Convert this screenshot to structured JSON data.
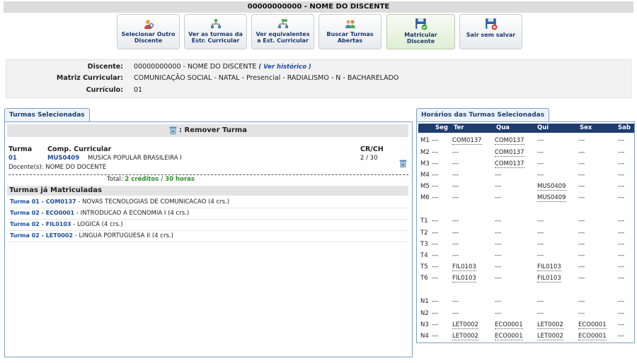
{
  "page_title": "00000000000 - NOME DO DISCENTE",
  "toolbar": [
    {
      "line1": "Selecionar Outro",
      "line2": "Discente",
      "icon": "user-search-icon"
    },
    {
      "line1": "Ver as turmas da",
      "line2": "Estr. Curricular",
      "icon": "hierarchy-icon"
    },
    {
      "line1": "Ver equivalentes",
      "line2": "a Est. Curricular",
      "icon": "hierarchy-plus-icon"
    },
    {
      "line1": "Buscar Turmas",
      "line2": "Abertas",
      "icon": "search-people-icon"
    },
    {
      "line1": "Matricular",
      "line2": "Discente",
      "icon": "save-check-icon"
    },
    {
      "line1": "Sair sem salvar",
      "line2": "",
      "icon": "save-cancel-icon"
    }
  ],
  "info": {
    "discente_label": "Discente:",
    "discente_value": "00000000000 - NOME DO DISCENTE",
    "historico_link": "( Ver histórico )",
    "matriz_label": "Matriz Curricular:",
    "matriz_value": "COMUNICAÇÃO SOCIAL - NATAL - Presencial - RADIALISMO - N - BACHARELADO",
    "curriculo_label": "Currículo:",
    "curriculo_value": "01"
  },
  "selected_tab": "Turmas Selecionadas",
  "remove_label": ": Remover Turma",
  "selected_headers": {
    "turma": "Turma",
    "comp": "Comp. Curricular",
    "crch": "CR/CH"
  },
  "selected_rows": [
    {
      "turma": "01",
      "code": "MUS0409",
      "name": "MUSICA POPULAR BRASILEIRA I",
      "crch": "2 / 30",
      "docente": "Docente(s): NOME DO DOCENTE"
    }
  ],
  "total_prefix": "Total:",
  "total_value": "2 créditos / 30 horas",
  "matriculadas_title": "Turmas já Matriculadas",
  "matriculadas": [
    {
      "turma": "Turma 01 -",
      "code": "COM0137",
      "desc": "- NOVAS TECNOLOGIAS DE COMUNICACAO (4 crs.)"
    },
    {
      "turma": "Turma 02 -",
      "code": "ECO0001",
      "desc": "- INTRODUCAO A ECONOMIA I (4 crs.)"
    },
    {
      "turma": "Turma 02 -",
      "code": "FIL0103",
      "desc": "- LOGICA (4 crs.)"
    },
    {
      "turma": "Turma 02 -",
      "code": "LET0002",
      "desc": "- LINGUA PORTUGUESA II (4 crs.)"
    }
  ],
  "schedule_tab": "Horários das Turmas Selecionadas",
  "schedule_days": [
    "Seg",
    "Ter",
    "Qua",
    "Qui",
    "Sex",
    "Sab"
  ],
  "schedule_rows": [
    {
      "slot": "M1",
      "cells": [
        "---",
        "COM0137",
        "COM0137",
        "---",
        "---",
        "---"
      ]
    },
    {
      "slot": "M2",
      "cells": [
        "---",
        "---",
        "COM0137",
        "---",
        "---",
        "---"
      ]
    },
    {
      "slot": "M3",
      "cells": [
        "---",
        "---",
        "COM0137",
        "---",
        "---",
        "---"
      ]
    },
    {
      "slot": "M4",
      "cells": [
        "---",
        "---",
        "---",
        "---",
        "---",
        "---"
      ]
    },
    {
      "slot": "M5",
      "cells": [
        "---",
        "---",
        "---",
        "MUS0409",
        "---",
        "---"
      ]
    },
    {
      "slot": "M6",
      "cells": [
        "---",
        "---",
        "---",
        "MUS0409",
        "---",
        "---"
      ]
    },
    {
      "slot": "T1",
      "cells": [
        "---",
        "---",
        "---",
        "---",
        "---",
        "---"
      ]
    },
    {
      "slot": "T2",
      "cells": [
        "---",
        "---",
        "---",
        "---",
        "---",
        "---"
      ]
    },
    {
      "slot": "T3",
      "cells": [
        "---",
        "---",
        "---",
        "---",
        "---",
        "---"
      ]
    },
    {
      "slot": "T4",
      "cells": [
        "---",
        "---",
        "---",
        "---",
        "---",
        "---"
      ]
    },
    {
      "slot": "T5",
      "cells": [
        "---",
        "FIL0103",
        "---",
        "FIL0103",
        "---",
        "---"
      ]
    },
    {
      "slot": "T6",
      "cells": [
        "---",
        "FIL0103",
        "---",
        "FIL0103",
        "---",
        "---"
      ]
    },
    {
      "slot": "N1",
      "cells": [
        "---",
        "---",
        "---",
        "---",
        "---",
        "---"
      ]
    },
    {
      "slot": "N2",
      "cells": [
        "---",
        "---",
        "---",
        "---",
        "---",
        "---"
      ]
    },
    {
      "slot": "N3",
      "cells": [
        "---",
        "LET0002",
        "ECO0001",
        "LET0002",
        "ECO0001",
        "---"
      ]
    },
    {
      "slot": "N4",
      "cells": [
        "---",
        "LET0002",
        "ECO0001",
        "LET0002",
        "ECO0001",
        "---"
      ]
    }
  ]
}
